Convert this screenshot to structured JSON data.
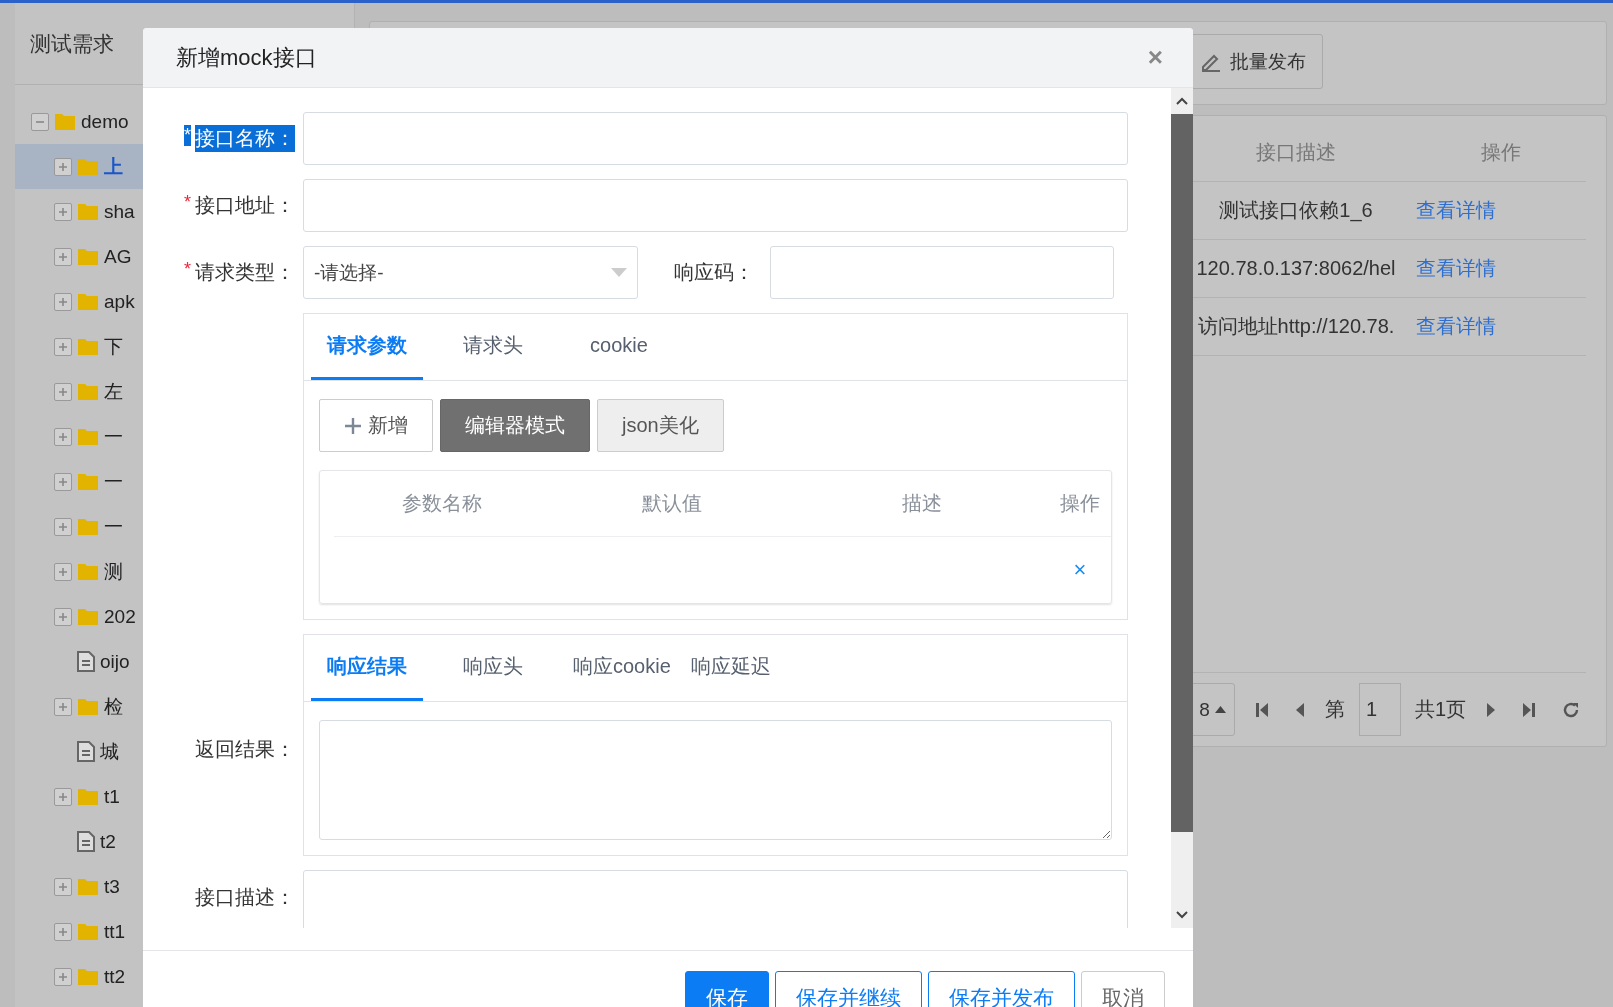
{
  "sidebar": {
    "title": "测试需求",
    "tree": [
      {
        "label": "demo",
        "kind": "folder",
        "expanded": true,
        "selected": false,
        "children": [
          {
            "label": "上",
            "kind": "folder",
            "expanded": false,
            "selected": true
          },
          {
            "label": "sha",
            "kind": "folder",
            "expanded": false,
            "selected": false
          },
          {
            "label": "AG",
            "kind": "folder",
            "expanded": false,
            "selected": false
          },
          {
            "label": "apk",
            "kind": "folder",
            "expanded": false,
            "selected": false
          },
          {
            "label": "下",
            "kind": "folder",
            "expanded": false,
            "selected": false
          },
          {
            "label": "左",
            "kind": "folder",
            "expanded": false,
            "selected": false
          },
          {
            "label": "一",
            "kind": "folder",
            "expanded": false,
            "selected": false
          },
          {
            "label": "一",
            "kind": "folder",
            "expanded": false,
            "selected": false
          },
          {
            "label": "一",
            "kind": "folder",
            "expanded": false,
            "selected": false
          },
          {
            "label": "测",
            "kind": "folder",
            "expanded": false,
            "selected": false
          },
          {
            "label": "202",
            "kind": "folder",
            "expanded": false,
            "selected": false
          },
          {
            "label": "oijo",
            "kind": "file",
            "selected": false
          },
          {
            "label": "检",
            "kind": "folder",
            "expanded": false,
            "selected": false
          },
          {
            "label": "城",
            "kind": "file",
            "selected": false
          },
          {
            "label": "t1",
            "kind": "folder",
            "expanded": false,
            "selected": false
          },
          {
            "label": "t2",
            "kind": "file",
            "selected": false
          },
          {
            "label": "t3",
            "kind": "folder",
            "expanded": false,
            "selected": false
          },
          {
            "label": "tt1",
            "kind": "folder",
            "expanded": false,
            "selected": false
          },
          {
            "label": "tt2",
            "kind": "folder",
            "expanded": false,
            "selected": false
          }
        ]
      }
    ]
  },
  "toolbar": {
    "button": "批量发布"
  },
  "table": {
    "columns": [
      "接口描述",
      "操作"
    ],
    "rows": [
      {
        "description": "测试接口依赖1_6",
        "action": "查看详情"
      },
      {
        "description": "120.78.0.137:8062/hel",
        "action": "查看详情"
      },
      {
        "description": "访问地址http://120.78.",
        "action": "查看详情"
      }
    ]
  },
  "pagination": {
    "page_size": "8",
    "page_label": "第",
    "page": "1",
    "total": "共1页"
  },
  "dialog": {
    "title": "新增mock接口",
    "close": "×",
    "fields": [
      {
        "label": "接口名称：",
        "required_mark": "*",
        "highlighted": true
      },
      {
        "label": "接口地址：",
        "required_mark": "*",
        "highlighted": false
      }
    ],
    "request_type": {
      "label": "请求类型：",
      "required_mark": "*",
      "placeholder": "-请选择-",
      "code_label": "响应码："
    },
    "request_tabs": [
      {
        "label": "请求参数",
        "selected": true
      },
      {
        "label": "请求头",
        "selected": false
      },
      {
        "label": "cookie",
        "selected": false
      }
    ],
    "param_buttons": [
      {
        "label": "新增",
        "kind": "add"
      },
      {
        "label": "编辑器模式",
        "kind": "dark"
      },
      {
        "label": "json美化",
        "kind": "light"
      }
    ],
    "param_columns": [
      "参数名称",
      "默认值",
      "描述",
      "操作"
    ],
    "param_delete": "×",
    "response_tabs": [
      {
        "label": "响应结果",
        "selected": true
      },
      {
        "label": "响应头",
        "selected": false
      },
      {
        "label": "响应cookie",
        "selected": false
      },
      {
        "label": "响应延迟",
        "selected": false
      }
    ],
    "result_label": "返回结果：",
    "description_label": "接口描述：",
    "footer_buttons": [
      {
        "label": "保存",
        "kind": "primary"
      },
      {
        "label": "保存并继续",
        "kind": "outline"
      },
      {
        "label": "保存并发布",
        "kind": "outline"
      },
      {
        "label": "取消",
        "kind": "plain"
      }
    ]
  }
}
